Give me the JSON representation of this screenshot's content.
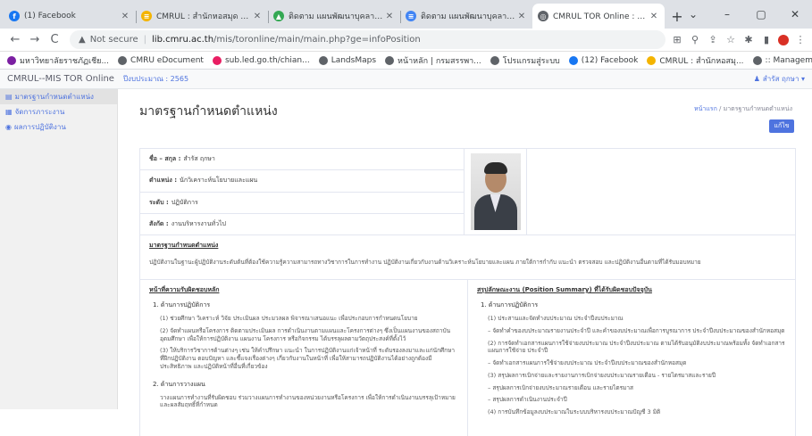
{
  "browser": {
    "tabs": [
      {
        "title": "(1) Facebook",
        "color": "#1877f2",
        "glyph": "f",
        "active": false
      },
      {
        "title": "CMRUL : สำนักหอสมุด มหาวิทย",
        "color": "#f4b400",
        "glyph": "≡",
        "active": false
      },
      {
        "title": "ติดตาม แผนพัฒนาบุคลากรสำนัก",
        "color": "#34a853",
        "glyph": "▲",
        "active": false
      },
      {
        "title": "ติดตาม แผนพัฒนาบุคลากร ชบป",
        "color": "#4285f4",
        "glyph": "≡",
        "active": false
      },
      {
        "title": "CMRUL TOR Online : ระบบงาน",
        "color": "#5f6368",
        "glyph": "◎",
        "active": true
      }
    ],
    "new_tab": "+",
    "window_controls": [
      "⌄",
      "–",
      "▢",
      "✕"
    ],
    "url_warning": "▲",
    "url_security": "Not secure",
    "url_host": "lib.cmru.ac.th",
    "url_path": "/mis/toronline/main/main.php?ge=infoPosition",
    "bookmarks": [
      {
        "label": "มหาวิทยาลัยราชภัฏเชีย...",
        "color": "#7b1fa2"
      },
      {
        "label": "CMRU eDocument",
        "color": "#5f6368"
      },
      {
        "label": "sub.led.go.th/chian...",
        "color": "#e91e63"
      },
      {
        "label": "LandsMaps",
        "color": "#5f6368"
      },
      {
        "label": "หน้าหลัก | กรมสรรพา...",
        "color": "#5f6368"
      },
      {
        "label": "โปรแกรมสู่ระบบ",
        "color": "#5f6368"
      },
      {
        "label": "(12) Facebook",
        "color": "#1877f2"
      },
      {
        "label": "CMRUL : สำนักหอสมุ...",
        "color": "#f4b400"
      },
      {
        "label": ":: Management Info...",
        "color": "#5f6368"
      }
    ],
    "bookmarks_more": "»"
  },
  "app": {
    "brand": "CMRUL--MIS TOR Online",
    "fiscal_year": "ปีงบประมาณ : 2565",
    "user": "สำรัส ฤกษา ▾"
  },
  "sidebar": {
    "items": [
      {
        "label": "มาตรฐานกำหนดตำแหน่ง",
        "icon": "▤"
      },
      {
        "label": "จัดการภาระงาน",
        "icon": "▦"
      },
      {
        "label": "ผลการปฏิบัติงาน",
        "icon": "◉"
      }
    ]
  },
  "page": {
    "title": "มาตรฐานกำหนดตำแหน่ง",
    "breadcrumb_home": "หน้าแรก",
    "breadcrumb_sep": "/",
    "breadcrumb_current": "มาตรฐานกำหนดตำแหน่ง",
    "edit_button": "แก้ไข"
  },
  "profile": {
    "name_label": "ชื่อ – สกุล :",
    "name_value": "สำรัส ฤกษา",
    "position_label": "ตำแหน่ง :",
    "position_value": "นักวิเคราะห์นโยบายและแผน",
    "level_label": "ระดับ :",
    "level_value": "ปฏิบัติการ",
    "unit_label": "สังกัด :",
    "unit_value": "งานบริหารงานทั่วไป"
  },
  "standard": {
    "heading": "มาตรฐานกำหนดตำแหน่ง",
    "text": "ปฏิบัติงานในฐานะผู้ปฏิบัติงานระดับต้นที่ต้องใช้ความรู้ความสามารถทางวิชาการในการทำงาน ปฏิบัติงานเกี่ยวกับงานด้านวิเคราะห์นโยบายและแผน ภายใต้การกำกับ แนะนำ ตรวจสอบ และปฏิบัติงานอื่นตามที่ได้รับมอบหมาย"
  },
  "duties": {
    "heading": "หน้าที่ความรับผิดชอบหลัก",
    "sections": [
      {
        "title": "1. ด้านการปฏิบัติการ",
        "lines": [
          "(1) ช่วยศึกษา วิเคราะห์ วิจัย ประเมินผล ประมวลผล พิจารณาเสนอแนะ เพื่อประกอบการกำหนดนโยบาย",
          "(2) จัดทำแผนหรือโครงการ ติดตามประเมินผล การดำเนินงานตามแผนและโครงการต่างๆ ซึ่งเป็นแผนงานของสถาบันอุดมศึกษา เพื่อให้การปฏิบัติงาน แผนงาน โครงการ หรือกิจกรรม ได้บรรลุผลตามวัตถุประสงค์ที่ตั้งไว้",
          "(3) ให้บริการวิชาการด้านต่างๆ เช่น ให้คำปรึกษา แนะนำ ในการปฏิบัติงานแก่เจ้าหน้าที่ ระดับรองลงมาและแก่นักศึกษาที่ฝึกปฏิบัติงาน ตอบปัญหา และชี้แจงเรื่องต่างๆ เกี่ยวกับงานในหน้าที่ เพื่อให้สามารถปฏิบัติงานได้อย่างถูกต้องมีประสิทธิภาพ และปฏิบัติหน้าที่อื่นที่เกี่ยวข้อง"
        ]
      },
      {
        "title": "2. ด้านการวางแผน",
        "lines": [
          "วางแผนการทำงานที่รับผิดชอบ ร่วมวางแผนการทำงานของหน่วยงานหรือโครงการ เพื่อให้การดำเนินงานบรรลุเป้าหมายและผลสัมฤทธิ์ที่กำหนด"
        ]
      }
    ]
  },
  "summary": {
    "heading": "สรุปลักษณะงาน (Position Summary) ที่ได้รับผิดชอบปัจจุบัน",
    "sections": [
      {
        "title": "1. ด้านการปฏิบัติการ",
        "lines": [
          "(1) ประสานและจัดทำงบประมาณ ประจำปีงบประมาณ",
          "– จัดทำคำของบประมาณรายงานประจำปี และคำของบประมาณเพื่อการบูรณาการ ประจำปีงบประมาณของสำนักหอสมุด",
          "(2) การจัดทำเอกสารแผนการใช้จ่ายงบประมาณ ประจำปีงบประมาณ ตามได้รับอนุมัติงบประมาณพร้อมทั้ง จัดทำเอกสารแผนการใช้จ่าย ประจำปี",
          "– จัดทำเอกสารแผนการใช้จ่ายงบประมาณ ประจำปีงบประมาณของสำนักหอสมุด",
          "(3) สรุปผลการเบิกจ่ายและรายงานการเบิกจ่ายงบประมาณรายเดือน - รายไตรมาสและรายปี",
          "– สรุปผลการเบิกจ่ายงบประมาณรายเดือน และรายไตรมาส",
          "– สรุปผลการดำเนินงานประจำปี",
          "(4) การบันทึกข้อมูลงบประมาณในระบบบริหารงบประมาณปัญชี 3 มิติ"
        ]
      }
    ]
  }
}
